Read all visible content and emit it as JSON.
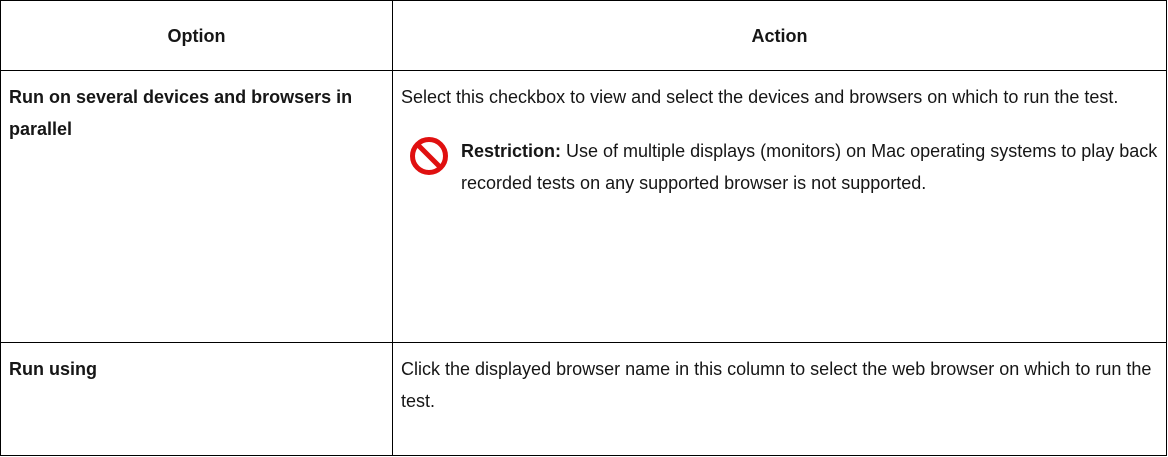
{
  "table": {
    "headers": {
      "option": "Option",
      "action": "Action"
    },
    "rows": [
      {
        "option": "Run on several devices and browsers in parallel",
        "action": "Select this checkbox to view and select the devices and browsers on which to run the test.",
        "note": {
          "icon": "restriction-icon",
          "label": "Restriction:",
          "text": "Use of multiple displays (monitors) on Mac operating systems to play back recorded tests on any supported browser is not supported."
        }
      },
      {
        "option": "Run using",
        "action": "Click the displayed browser name in this column to select the web browser on which to run the test."
      }
    ]
  },
  "colors": {
    "border": "#000000",
    "text": "#161616",
    "restriction_icon": "#e01010"
  }
}
